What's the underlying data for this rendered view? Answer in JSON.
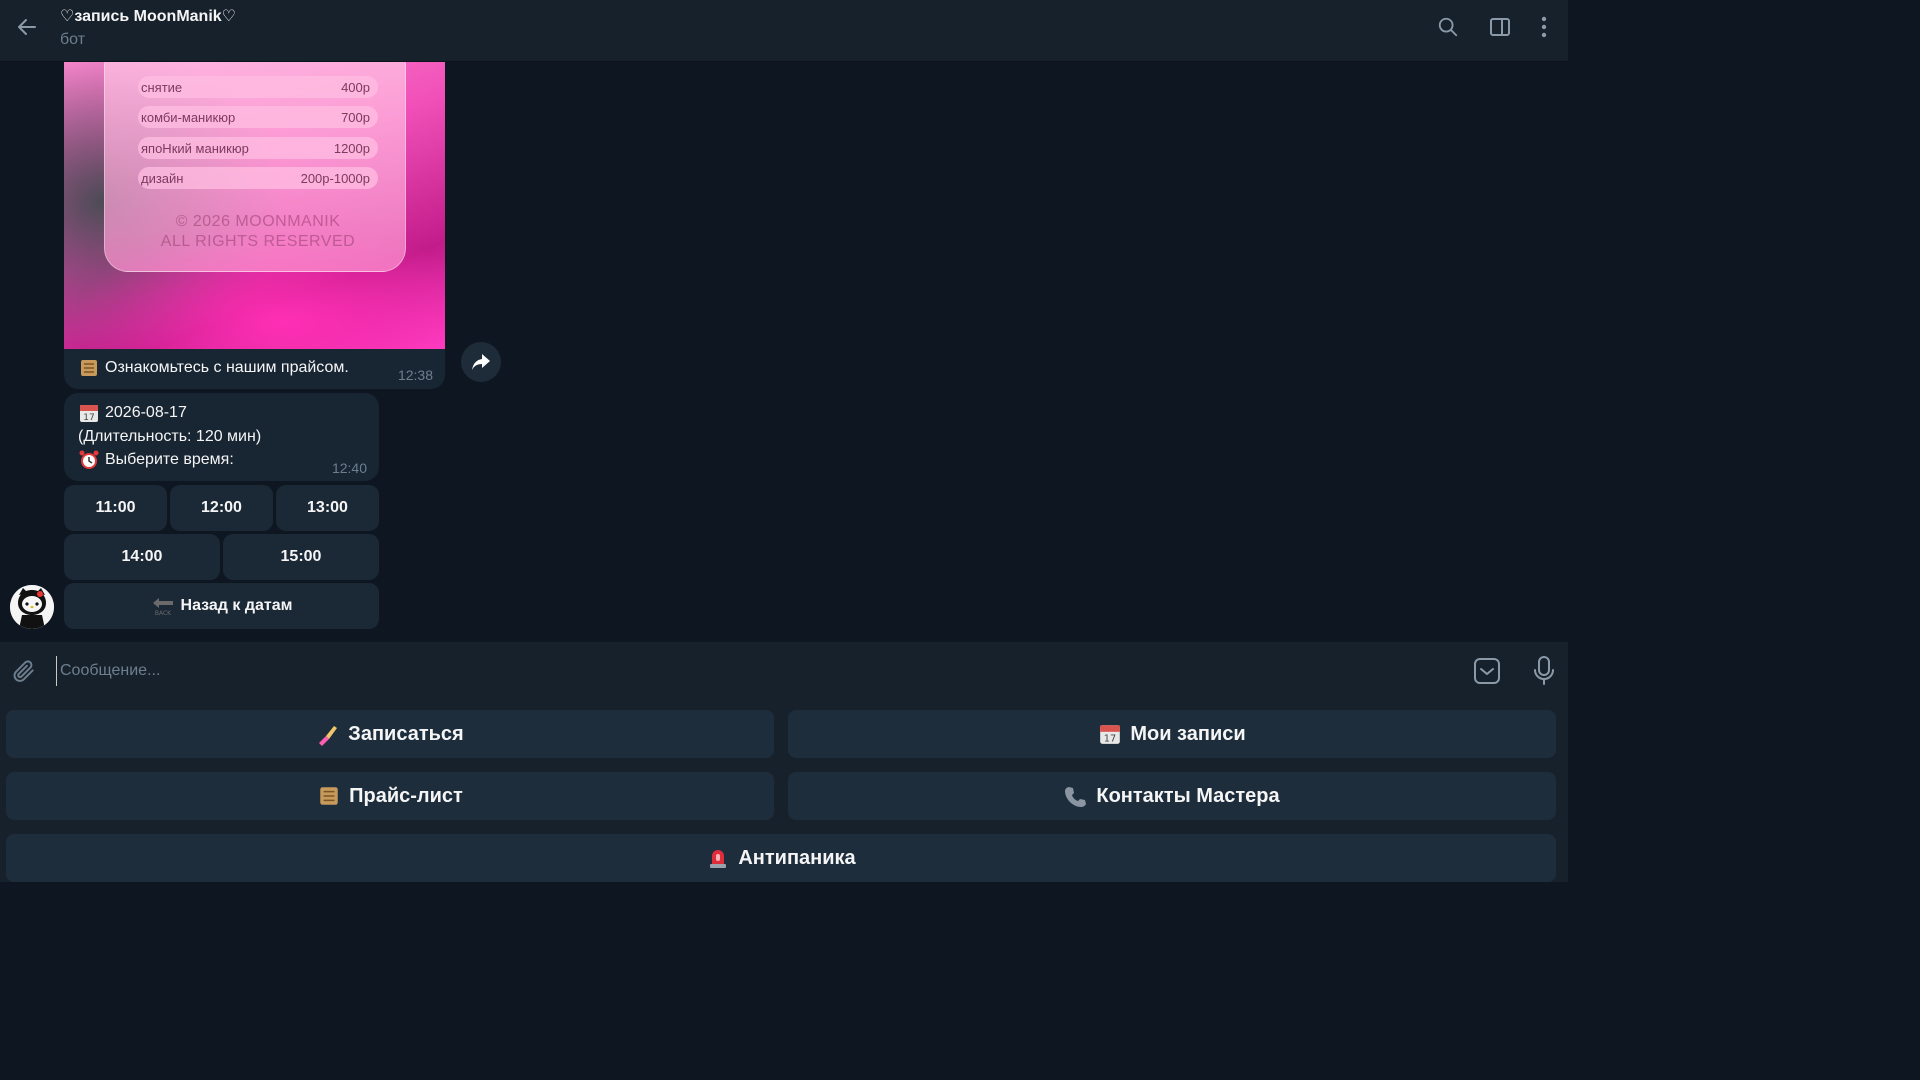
{
  "header": {
    "title": "♡запись MoonManik♡",
    "subtitle": "бот"
  },
  "messages": {
    "photo": {
      "price_rows": [
        {
          "name": "снятие",
          "price": "400р"
        },
        {
          "name": "комби-маникюр",
          "price": "700р"
        },
        {
          "name": "япоНкий маникюр",
          "price": "1200р"
        },
        {
          "name": "дизайн",
          "price": "200р-1000р"
        }
      ],
      "copyright_line1": "© 2026 MOONMANIK",
      "copyright_line2": "ALL RIGHTS RESERVED",
      "caption": "Ознакомьтесь с нашим прайсом.",
      "time": "12:38"
    },
    "date_msg": {
      "date": "2026-08-17",
      "duration": "(Длительность: 120 мин)",
      "prompt": "Выберите время:",
      "time": "12:40"
    },
    "inline_keyboard": {
      "slots": [
        "11:00",
        "12:00",
        "13:00",
        "14:00",
        "15:00"
      ],
      "back_label": "Назад к датам"
    }
  },
  "input": {
    "placeholder": "Сообщение..."
  },
  "reply_keyboard": {
    "book": "Записаться",
    "my_bookings": "Мои записи",
    "price_list": "Прайс-лист",
    "contacts": "Контакты Мастера",
    "antipanic": "Антипаника"
  },
  "colors": {
    "background": "#0e1621",
    "header": "#17212b",
    "bubble": "#182533",
    "button": "#1d2d3c",
    "muted_text": "#6d7f8f"
  },
  "icons": [
    "back-arrow-icon",
    "search-icon",
    "sidebar-panel-icon",
    "more-vertical-icon",
    "forward-icon",
    "paperclip-icon",
    "keyboard-toggle-icon",
    "microphone-icon"
  ]
}
